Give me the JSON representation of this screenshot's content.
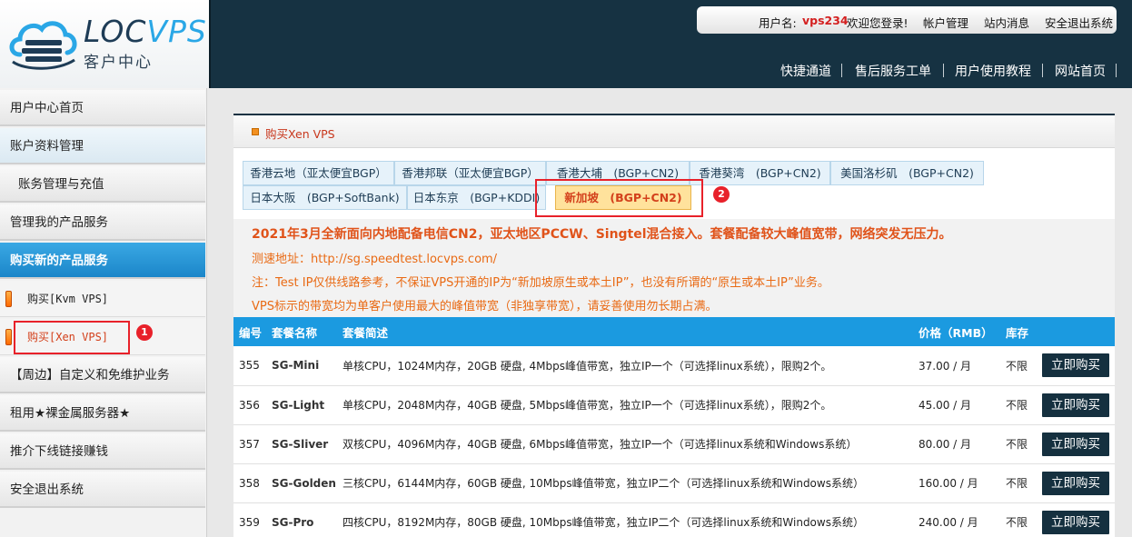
{
  "logo": {
    "text_loc": "LOC",
    "text_vps": "VPS",
    "subtitle": "客户中心"
  },
  "userbar": {
    "username_label": "用户名:",
    "username": "vps234",
    "welcome": "欢迎您登录!",
    "links": [
      "帐户管理",
      "站内消息",
      "安全退出系统"
    ]
  },
  "topnav": [
    "快捷通道",
    "售后服务工单",
    "用户使用教程",
    "网站首页"
  ],
  "sidebar": {
    "items": [
      {
        "label": "用户中心首页"
      },
      {
        "label": "账户资料管理"
      },
      {
        "label": "账务管理与充值"
      },
      {
        "label": "管理我的产品服务"
      },
      {
        "label": "购买新的产品服务"
      },
      {
        "label": "购买[Kvm VPS]"
      },
      {
        "label": "购买[Xen VPS]"
      },
      {
        "label": "【周边】自定义和免维护业务"
      },
      {
        "label": "租用★裸金属服务器★"
      },
      {
        "label": "推介下线链接赚钱"
      },
      {
        "label": "安全退出系统"
      }
    ]
  },
  "panel": {
    "title": "购买Xen VPS"
  },
  "tabs": [
    "香港云地（亚太便宜BGP）",
    "香港邦联（亚太便宜BGP）",
    "香港大埔　(BGP+CN2)",
    "香港葵湾　(BGP+CN2)",
    "美国洛杉矶　(BGP+CN2)",
    "日本大阪　(BGP+SoftBank)",
    "日本东京　(BGP+KDDI)",
    "新加坡　(BGP+CN2)"
  ],
  "badges": [
    "1",
    "2"
  ],
  "notice": {
    "headline": "2021年3月全新面向内地配备电信CN2，亚太地区PCCW、Singtel混合接入。套餐配备较大峰值宽带，网络突发无压力。",
    "line2": "测速地址：http://sg.speedtest.locvps.com/",
    "line3": "注：Test IP仅供线路参考，不保证VPS开通的IP为“新加坡原生或本土IP”，也没有所谓的“原生或本土IP”业务。",
    "line4": "VPS标示的带宽均为单客户使用最大的峰值带宽（非独享带宽），请妥善使用勿长期占满。"
  },
  "table": {
    "headers": [
      "编号",
      "套餐名称",
      "套餐简述",
      "价格（RMB）",
      "库存",
      ""
    ],
    "buy_label": "立即购买",
    "rows": [
      {
        "id": "355",
        "name": "SG-Mini",
        "desc": "单核CPU，1024M内存，20GB 硬盘, 4Mbps峰值带宽，独立IP一个（可选择linux系统），限购2个。",
        "price": "37.00 / 月",
        "stock": "不限"
      },
      {
        "id": "356",
        "name": "SG-Light",
        "desc": "单核CPU，2048M内存，40GB 硬盘, 5Mbps峰值带宽，独立IP一个（可选择linux系统），限购2个。",
        "price": "45.00 / 月",
        "stock": "不限"
      },
      {
        "id": "357",
        "name": "SG-Sliver",
        "desc": "双核CPU，4096M内存，40GB 硬盘, 6Mbps峰值带宽，独立IP一个（可选择linux系统和Windows系统）",
        "price": "80.00 / 月",
        "stock": "不限"
      },
      {
        "id": "358",
        "name": "SG-Golden",
        "desc": "三核CPU，6144M内存，60GB 硬盘, 10Mbps峰值带宽，独立IP二个（可选择linux系统和Windows系统）",
        "price": "160.00 / 月",
        "stock": "不限"
      },
      {
        "id": "359",
        "name": "SG-Pro",
        "desc": "四核CPU，8192M内存，80GB 硬盘, 10Mbps峰值带宽，独立IP二个（可选择linux系统和Windows系统）",
        "price": "240.00 / 月",
        "stock": "不限"
      }
    ]
  }
}
